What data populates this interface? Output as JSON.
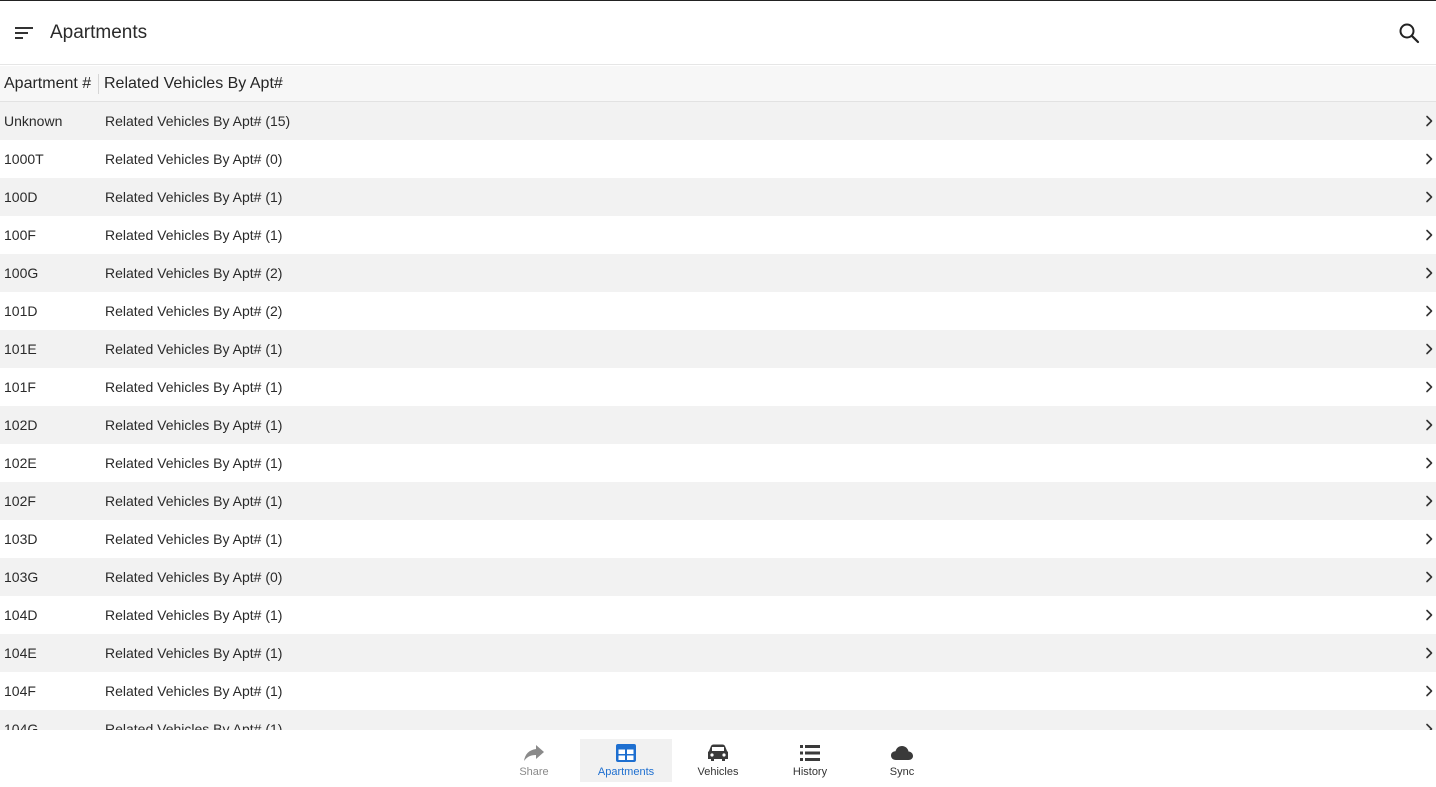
{
  "app_bar": {
    "title": "Apartments",
    "menu_icon": "sort-menu-icon",
    "search_icon": "search-icon"
  },
  "table": {
    "columns": [
      "Apartment #",
      "Related Vehicles By Apt#"
    ],
    "rows": [
      {
        "apt": "Unknown",
        "related": "Related Vehicles By Apt# (15)"
      },
      {
        "apt": "1000T",
        "related": "Related Vehicles By Apt# (0)"
      },
      {
        "apt": "100D",
        "related": "Related Vehicles By Apt# (1)"
      },
      {
        "apt": "100F",
        "related": "Related Vehicles By Apt# (1)"
      },
      {
        "apt": "100G",
        "related": "Related Vehicles By Apt# (2)"
      },
      {
        "apt": "101D",
        "related": "Related Vehicles By Apt# (2)"
      },
      {
        "apt": "101E",
        "related": "Related Vehicles By Apt# (1)"
      },
      {
        "apt": "101F",
        "related": "Related Vehicles By Apt# (1)"
      },
      {
        "apt": "102D",
        "related": "Related Vehicles By Apt# (1)"
      },
      {
        "apt": "102E",
        "related": "Related Vehicles By Apt# (1)"
      },
      {
        "apt": "102F",
        "related": "Related Vehicles By Apt# (1)"
      },
      {
        "apt": "103D",
        "related": "Related Vehicles By Apt# (1)"
      },
      {
        "apt": "103G",
        "related": "Related Vehicles By Apt# (0)"
      },
      {
        "apt": "104D",
        "related": "Related Vehicles By Apt# (1)"
      },
      {
        "apt": "104E",
        "related": "Related Vehicles By Apt# (1)"
      },
      {
        "apt": "104F",
        "related": "Related Vehicles By Apt# (1)"
      },
      {
        "apt": "104G",
        "related": "Related Vehicles By Apt# (1)"
      }
    ]
  },
  "bottom_nav": {
    "items": [
      {
        "label": "Share",
        "icon": "share-icon",
        "active": false
      },
      {
        "label": "Apartments",
        "icon": "table-grid-icon",
        "active": true
      },
      {
        "label": "Vehicles",
        "icon": "car-icon",
        "active": false
      },
      {
        "label": "History",
        "icon": "list-icon",
        "active": false
      },
      {
        "label": "Sync",
        "icon": "cloud-icon",
        "active": false
      }
    ]
  },
  "colors": {
    "accent": "#1e6fd0",
    "row_alt": "#f2f2f2",
    "text": "#2a2a2a",
    "inactive_icon": "#8a8a8a"
  }
}
